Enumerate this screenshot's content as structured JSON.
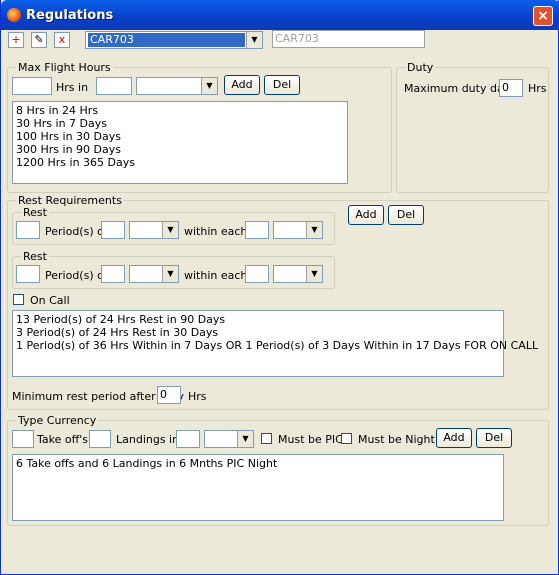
{
  "window": {
    "title": "Regulations",
    "close": "×"
  },
  "toolbar": {
    "new_icon": "+",
    "edit_icon": "✎",
    "delete_icon": "x"
  },
  "regulation_select": {
    "value": "CAR703"
  },
  "regulation_name": {
    "value": "CAR703"
  },
  "max_flight_hours": {
    "legend": "Max Flight Hours",
    "hrs_value": "",
    "hrs_in_label": "Hrs in",
    "period_value": "",
    "unit_value": "",
    "add_label": "Add",
    "del_label": "Del",
    "items": [
      "8 Hrs in 24 Hrs",
      "30 Hrs in 7 Days",
      "100 Hrs in 30 Days",
      "300 Hrs in 90 Days",
      "1200 Hrs in 365 Days"
    ]
  },
  "duty": {
    "legend": "Duty",
    "max_duty_label": "Maximum duty day",
    "max_duty_value": "0",
    "hrs_label": "Hrs"
  },
  "rest_requirements": {
    "legend": "Rest Requirements",
    "rest1": {
      "legend": "Rest",
      "count": "",
      "periods_label": "Period(s) of",
      "period": "",
      "unit": "",
      "within_label": "within each",
      "within": "",
      "within_unit": ""
    },
    "rest2": {
      "legend": "Rest",
      "count": "",
      "periods_label": "Period(s) of",
      "period": "",
      "unit": "",
      "within_label": "within each",
      "within": "",
      "within_unit": ""
    },
    "add_label": "Add",
    "del_label": "Del",
    "on_call_label": "On Call",
    "items": [
      "13 Period(s) of 24 Hrs Rest in 90 Days",
      "3 Period(s) of 24 Hrs Rest in 30 Days",
      "1 Period(s) of 36 Hrs Within in 7 Days  OR 1 Period(s) of 3 Days Within in 17 Days  FOR ON CALL"
    ],
    "min_rest_label": "Minimum rest period after duty",
    "min_rest_value": "0",
    "min_rest_unit": "Hrs"
  },
  "type_currency": {
    "legend": "Type Currency",
    "takeoffs_value": "",
    "takeoffs_label": "Take off's",
    "landings_value": "",
    "landings_label": "Landings in",
    "period_value": "",
    "unit_value": "",
    "must_be_pic_label": "Must be PIC",
    "must_be_night_label": "Must be Night",
    "add_label": "Add",
    "del_label": "Del",
    "items": [
      "6 Take offs and 6 Landings in 6 Mnths PIC Night"
    ]
  }
}
